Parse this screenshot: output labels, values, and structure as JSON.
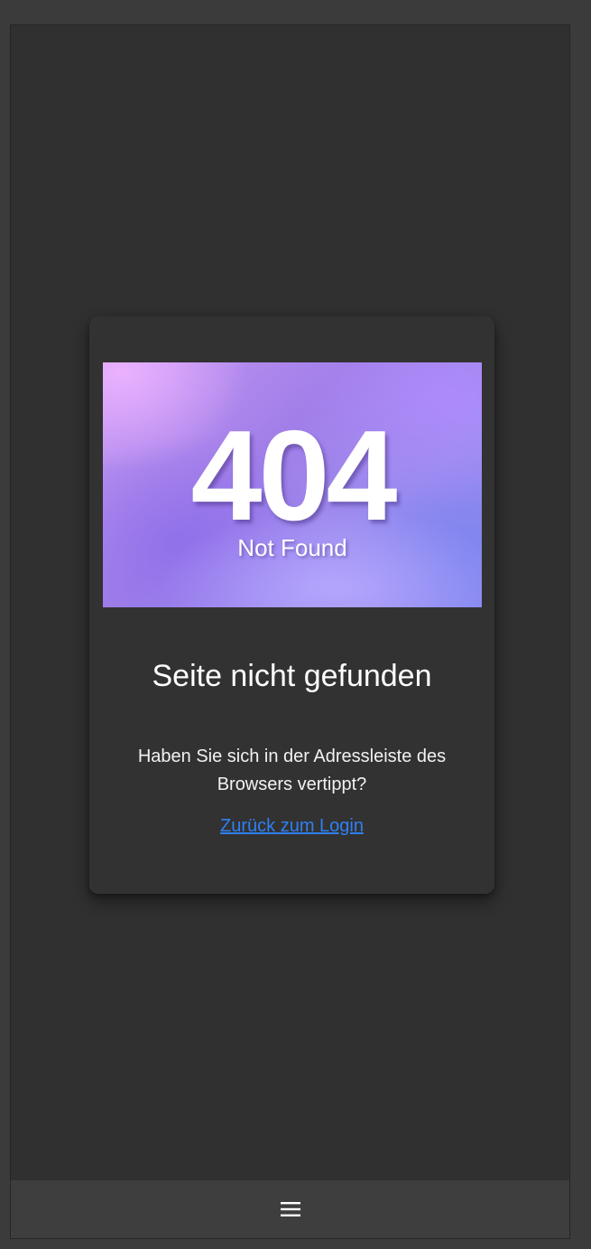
{
  "hero": {
    "code": "404",
    "subtitle": "Not Found"
  },
  "card": {
    "title": "Seite nicht gefunden",
    "message": "Haben Sie sich in der Adressleiste des Browsers vertippt?",
    "link_label": "Zurück zum Login"
  },
  "bottom_bar": {
    "menu_icon": "hamburger-menu-icon"
  },
  "colors": {
    "page_background": "#303030",
    "card_background": "#323232",
    "link": "#2f80f5",
    "bottom_bar": "#3e3e3e"
  }
}
